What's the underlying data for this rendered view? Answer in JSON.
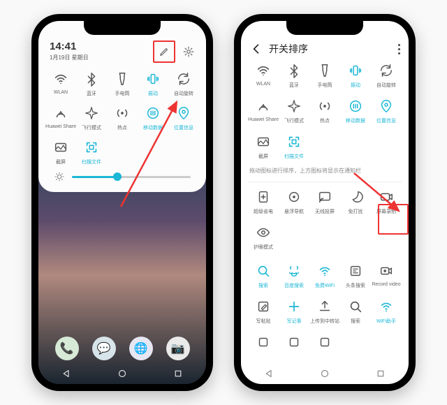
{
  "left": {
    "status": {
      "time": "14:41",
      "date": "1月19日 星期日"
    },
    "tiles": [
      {
        "id": "wlan",
        "label": "WLAN",
        "active": false
      },
      {
        "id": "bt",
        "label": "蓝牙",
        "active": false
      },
      {
        "id": "torch",
        "label": "手电筒",
        "active": false
      },
      {
        "id": "vibe",
        "label": "振动",
        "active": true
      },
      {
        "id": "rotate",
        "label": "自动旋转",
        "active": false
      },
      {
        "id": "hshare",
        "label": "Huawei Share",
        "active": false
      },
      {
        "id": "plane",
        "label": "飞行模式",
        "active": false
      },
      {
        "id": "hot",
        "label": "热点",
        "active": false
      },
      {
        "id": "data",
        "label": "移动数据",
        "active": true
      },
      {
        "id": "loc",
        "label": "位置信息",
        "active": true
      },
      {
        "id": "shot",
        "label": "截屏",
        "active": false
      },
      {
        "id": "scan",
        "label": "扫描文件",
        "active": true
      }
    ],
    "slider_percent": 38,
    "dock": [
      {
        "id": "phone",
        "bg": "#d7ead7",
        "glyph": "📞"
      },
      {
        "id": "msg",
        "bg": "#d7e4ea",
        "glyph": "💬"
      },
      {
        "id": "browser",
        "bg": "#e6e6f2",
        "glyph": "🌐"
      },
      {
        "id": "camera",
        "bg": "#eaeaea",
        "glyph": "📷"
      }
    ]
  },
  "right": {
    "title": "开关排序",
    "tiles_top": [
      {
        "id": "wlan",
        "label": "WLAN",
        "active": false
      },
      {
        "id": "bt",
        "label": "蓝牙",
        "active": false
      },
      {
        "id": "torch",
        "label": "手电筒",
        "active": false
      },
      {
        "id": "vibe",
        "label": "振动",
        "active": true
      },
      {
        "id": "rotate",
        "label": "自动旋转",
        "active": false
      },
      {
        "id": "hshare",
        "label": "Huawei Share",
        "active": false
      },
      {
        "id": "plane",
        "label": "飞行模式",
        "active": false
      },
      {
        "id": "hot",
        "label": "热点",
        "active": false
      },
      {
        "id": "data",
        "label": "移动数据",
        "active": true
      },
      {
        "id": "loc",
        "label": "位置信息",
        "active": true
      },
      {
        "id": "shot",
        "label": "截屏",
        "active": false
      },
      {
        "id": "scan",
        "label": "扫描文件",
        "active": true
      }
    ],
    "hint": "拖动图标进行排序，上方图标将显示在通知栏",
    "tiles_bottom": [
      {
        "id": "save",
        "label": "超级省电",
        "active": false
      },
      {
        "id": "float",
        "label": "悬浮导航",
        "active": false
      },
      {
        "id": "cast",
        "label": "无线投屏",
        "active": false
      },
      {
        "id": "dnd",
        "label": "免打扰",
        "active": false
      },
      {
        "id": "srec",
        "label": "屏幕录制",
        "active": false
      },
      {
        "id": "eye",
        "label": "护眼模式",
        "active": false
      }
    ],
    "tiles_extra": [
      {
        "id": "search",
        "label": "搜索",
        "active": true
      },
      {
        "id": "baidu",
        "label": "百度搜索",
        "active": true
      },
      {
        "id": "wifi",
        "label": "免费WiFi",
        "active": true
      },
      {
        "id": "head",
        "label": "头条搜索",
        "active": false
      },
      {
        "id": "recv",
        "label": "Record video",
        "active": false
      },
      {
        "id": "clip",
        "label": "写粘贴",
        "active": false
      },
      {
        "id": "note",
        "label": "写记事",
        "active": true
      },
      {
        "id": "upload",
        "label": "上传到中转站",
        "active": false
      },
      {
        "id": "srch2",
        "label": "搜索",
        "active": false
      },
      {
        "id": "wifia",
        "label": "WiFi助手",
        "active": true
      },
      {
        "id": "x1",
        "label": "",
        "active": false
      },
      {
        "id": "x2",
        "label": "",
        "active": false
      },
      {
        "id": "x3",
        "label": "",
        "active": false
      }
    ]
  }
}
